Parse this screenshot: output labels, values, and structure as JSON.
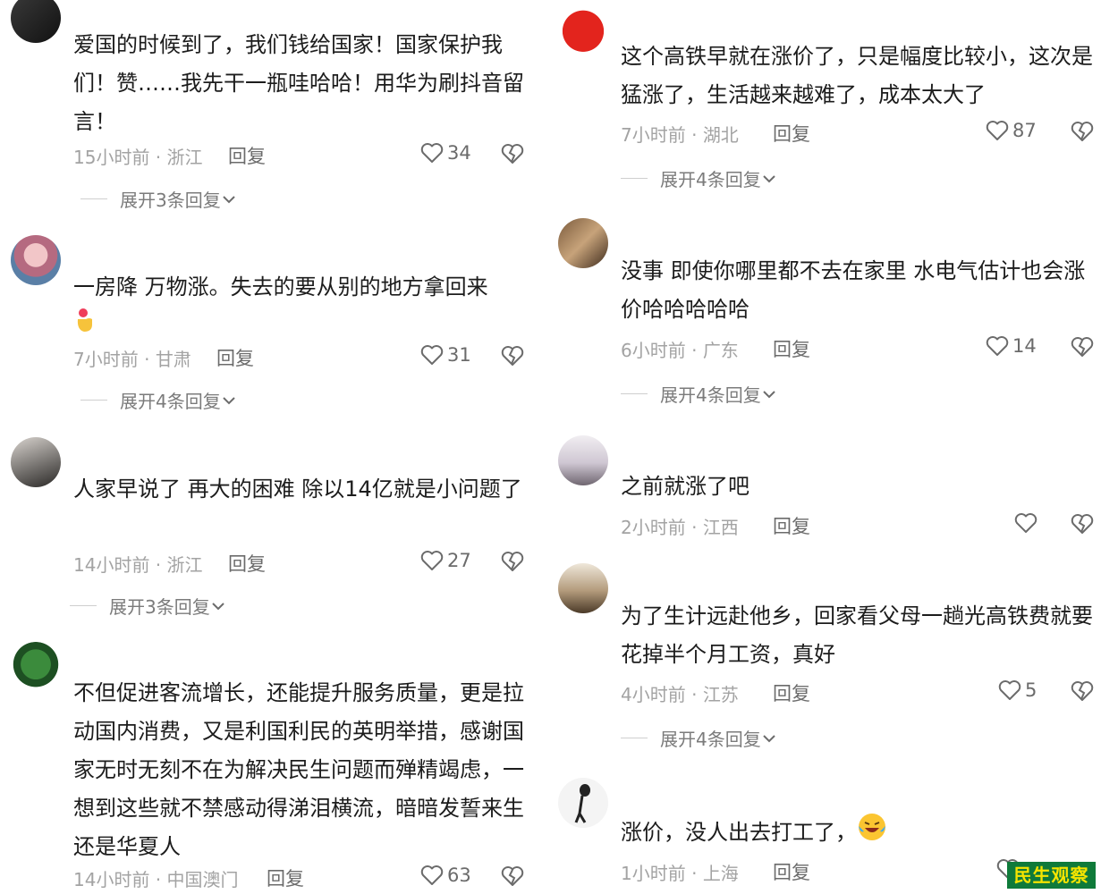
{
  "left_comments": [
    {
      "text": "爱国的时候到了，我们钱给国家！国家保护我们！赞……我先干一瓶哇哈哈！用华为刷抖音留言！",
      "time": "15小时前",
      "region": "浙江",
      "reply": "回复",
      "likes": "34",
      "expand": "展开3条回复"
    },
    {
      "text": "一房降 万物涨。失去的要从别的地方拿回来",
      "time": "7小时前",
      "region": "甘肃",
      "reply": "回复",
      "likes": "31",
      "expand": "展开4条回复"
    },
    {
      "text": "人家早说了 再大的困难 除以14亿就是小问题了",
      "time": "14小时前",
      "region": "浙江",
      "reply": "回复",
      "likes": "27",
      "expand": "展开3条回复"
    },
    {
      "text": "不但促进客流增长，还能提升服务质量，更是拉动国内消费，又是利国利民的英明举措，感谢国家无时无刻不在为解决民生问题而殚精竭虑，一想到这些就不禁感动得涕泪横流，暗暗发誓来生还是华夏人",
      "time": "14小时前",
      "region": "中国澳门",
      "reply": "回复",
      "likes": "63"
    }
  ],
  "right_comments": [
    {
      "text": "这个高铁早就在涨价了，只是幅度比较小，这次是猛涨了，生活越来越难了，成本太大了",
      "time": "7小时前",
      "region": "湖北",
      "reply": "回复",
      "likes": "87",
      "expand": "展开4条回复"
    },
    {
      "text": "没事 即使你哪里都不去在家里 水电气估计也会涨价哈哈哈哈哈",
      "time": "6小时前",
      "region": "广东",
      "reply": "回复",
      "likes": "14",
      "expand": "展开4条回复"
    },
    {
      "text": "之前就涨了吧",
      "time": "2小时前",
      "region": "江西",
      "reply": "回复",
      "likes": ""
    },
    {
      "text": "为了生计远赴他乡，回家看父母一趟光高铁费就要花掉半个月工资，真好",
      "time": "4小时前",
      "region": "江苏",
      "reply": "回复",
      "likes": "5",
      "expand": "展开4条回复"
    },
    {
      "text": "涨价，没人出去打工了，",
      "time": "1小时前",
      "region": "上海",
      "reply": "回复",
      "likes": ""
    }
  ],
  "meta_sep": " · ",
  "watermark": "民生观察",
  "icons": {
    "like": "heart-outline-icon",
    "dislike": "broken-heart-icon",
    "expand": "chevron-down-icon"
  }
}
